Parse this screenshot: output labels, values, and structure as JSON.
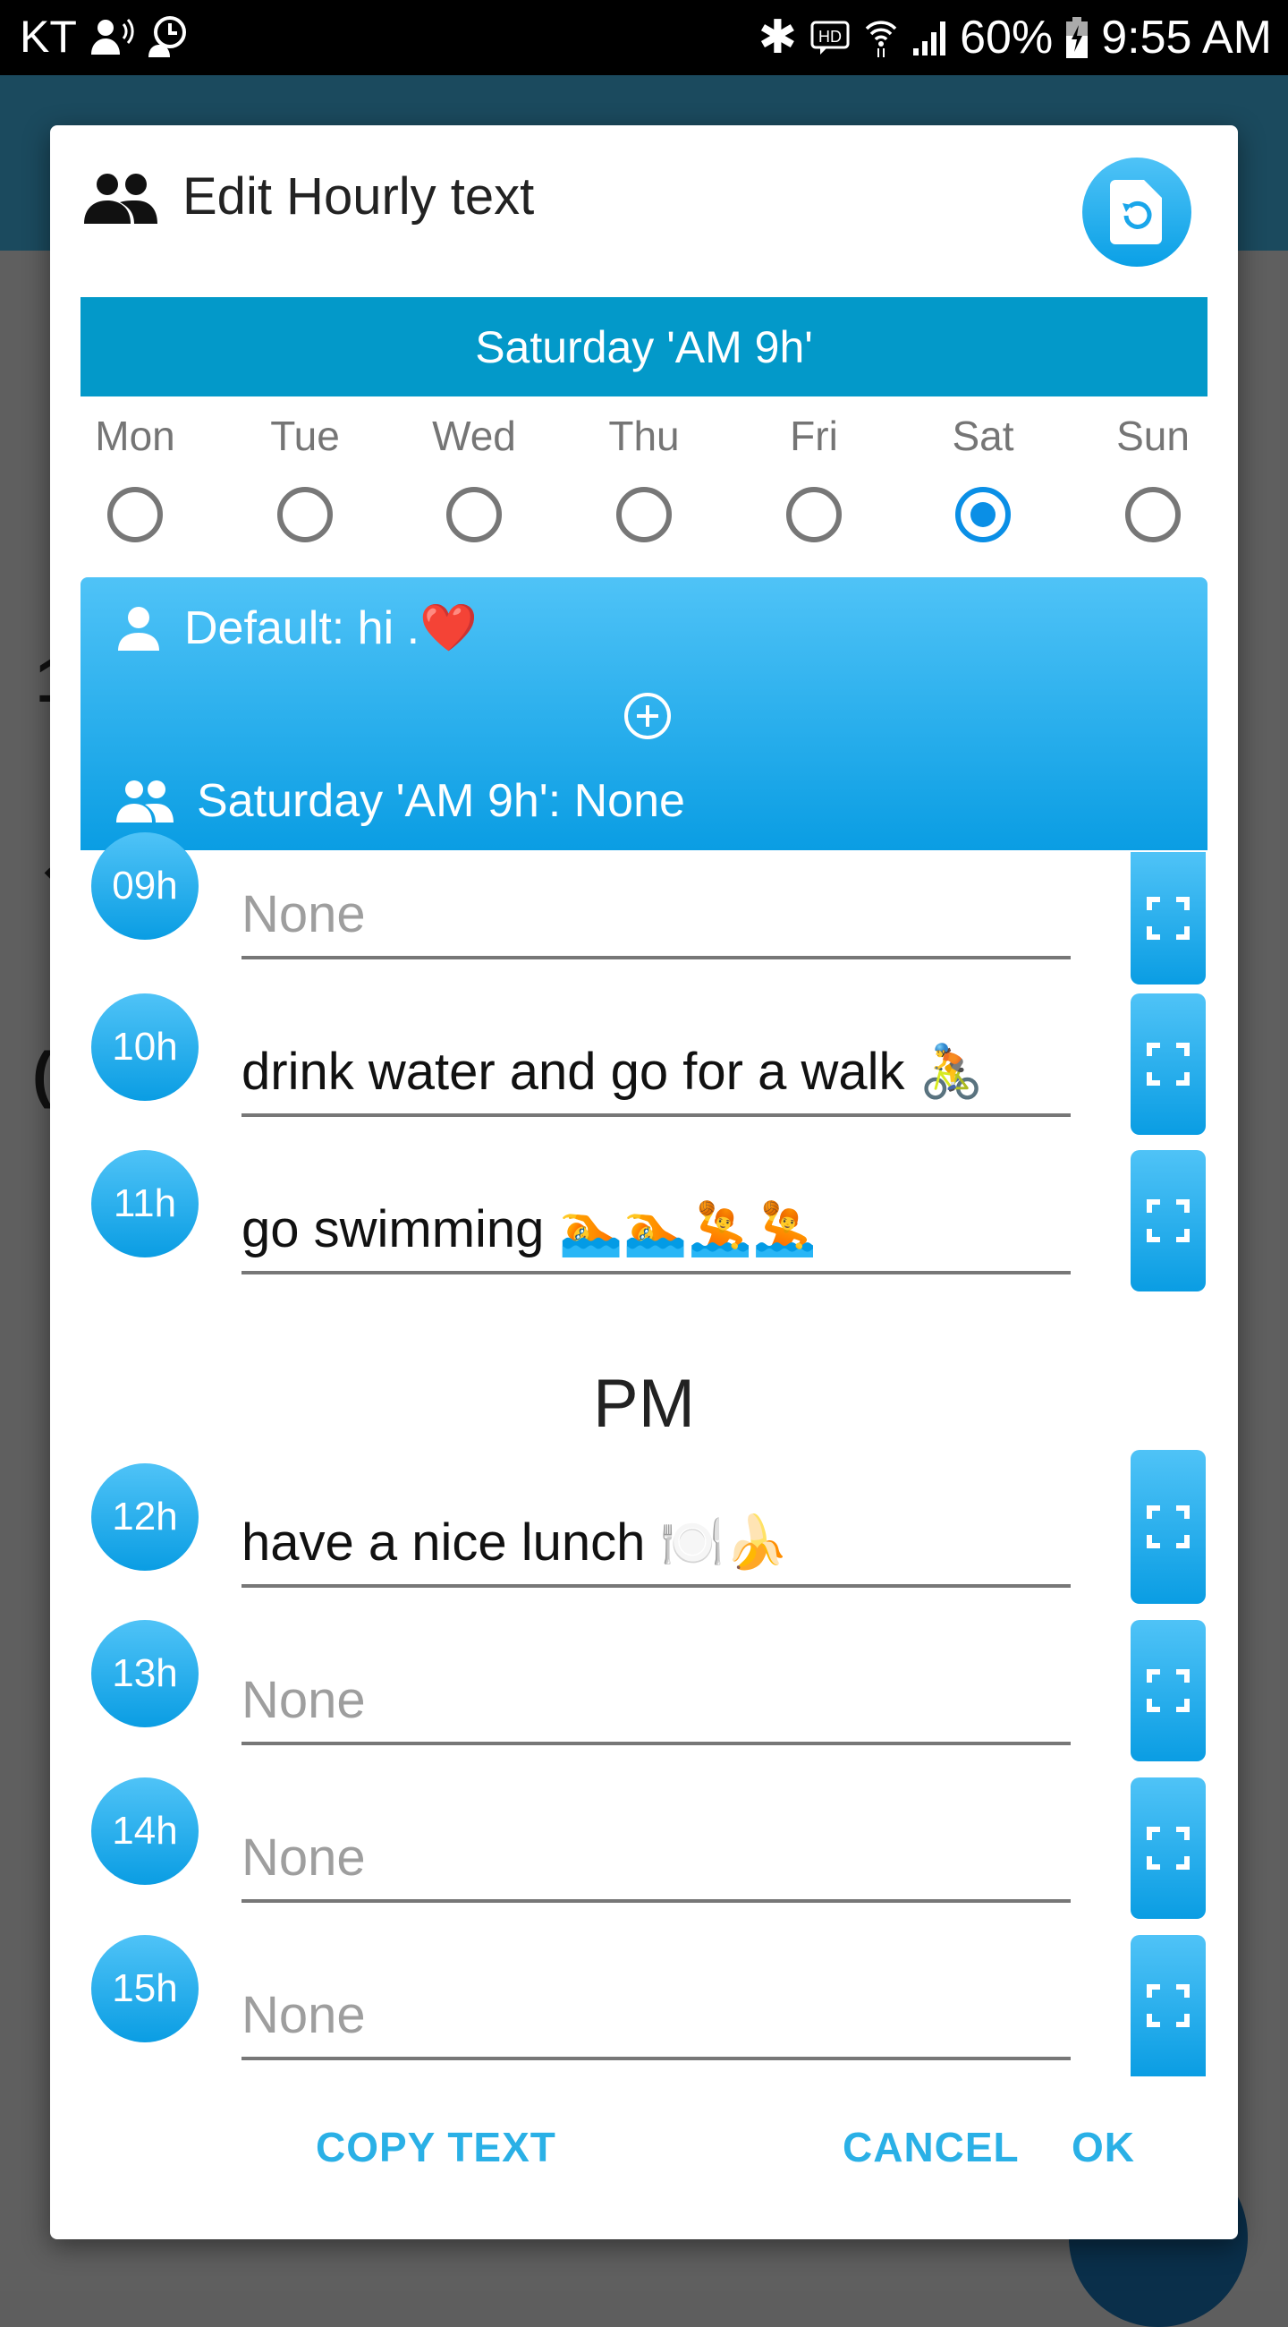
{
  "status_bar": {
    "carrier": "KT",
    "battery": "60%",
    "time": "9:55 AM",
    "icons": [
      "voice-call-icon",
      "alarm-icon",
      "bluetooth-icon",
      "hd-voice-icon",
      "wifi-icon",
      "signal-icon",
      "battery-charging-icon"
    ]
  },
  "dialog": {
    "title": "Edit Hourly text",
    "title_icon": "group-icon",
    "restore_button_icon": "file-restore-icon",
    "header": "Saturday 'AM 9h'",
    "days": [
      {
        "label": "Mon",
        "selected": false
      },
      {
        "label": "Tue",
        "selected": false
      },
      {
        "label": "Wed",
        "selected": false
      },
      {
        "label": "Thu",
        "selected": false
      },
      {
        "label": "Fri",
        "selected": false
      },
      {
        "label": "Sat",
        "selected": true
      },
      {
        "label": "Sun",
        "selected": false
      }
    ],
    "summary": {
      "default_text": "Default: hi  .❤️",
      "specific_text": "Saturday 'AM 9h': None"
    },
    "am_rows": [
      {
        "hour": "09h",
        "value": "",
        "placeholder": "None"
      },
      {
        "hour": "10h",
        "value": "drink water and go for a walk 🚴",
        "placeholder": "None"
      },
      {
        "hour": "11h",
        "value": "go swimming 🏊🏊🤽🤽",
        "placeholder": "None"
      }
    ],
    "pm_label": "PM",
    "pm_rows": [
      {
        "hour": "12h",
        "value": "have a nice lunch 🍽️🍌",
        "placeholder": "None"
      },
      {
        "hour": "13h",
        "value": "",
        "placeholder": "None"
      },
      {
        "hour": "14h",
        "value": "",
        "placeholder": "None"
      },
      {
        "hour": "15h",
        "value": "",
        "placeholder": "None"
      }
    ],
    "actions": {
      "copy_text": "COPY TEXT",
      "cancel": "CANCEL",
      "ok": "OK"
    }
  },
  "colors": {
    "accent": "#0399c9",
    "accent_light": "#4fc3f7",
    "button_text": "#2ab0e6",
    "radio_selected": "#0a8fe6"
  }
}
